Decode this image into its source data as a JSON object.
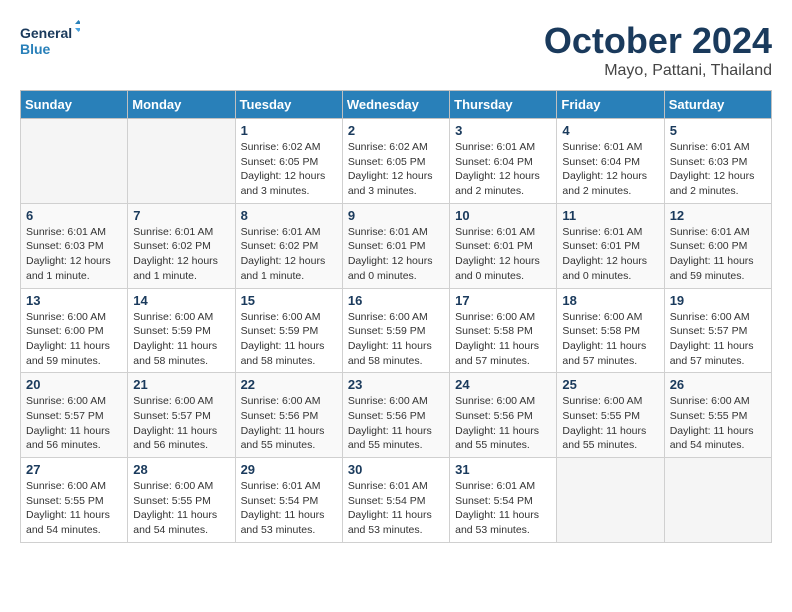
{
  "logo": {
    "general": "General",
    "blue": "Blue"
  },
  "header": {
    "month": "October 2024",
    "location": "Mayo, Pattani, Thailand"
  },
  "weekdays": [
    "Sunday",
    "Monday",
    "Tuesday",
    "Wednesday",
    "Thursday",
    "Friday",
    "Saturday"
  ],
  "weeks": [
    [
      {
        "day": "",
        "info": ""
      },
      {
        "day": "",
        "info": ""
      },
      {
        "day": "1",
        "info": "Sunrise: 6:02 AM\nSunset: 6:05 PM\nDaylight: 12 hours and 3 minutes."
      },
      {
        "day": "2",
        "info": "Sunrise: 6:02 AM\nSunset: 6:05 PM\nDaylight: 12 hours and 3 minutes."
      },
      {
        "day": "3",
        "info": "Sunrise: 6:01 AM\nSunset: 6:04 PM\nDaylight: 12 hours and 2 minutes."
      },
      {
        "day": "4",
        "info": "Sunrise: 6:01 AM\nSunset: 6:04 PM\nDaylight: 12 hours and 2 minutes."
      },
      {
        "day": "5",
        "info": "Sunrise: 6:01 AM\nSunset: 6:03 PM\nDaylight: 12 hours and 2 minutes."
      }
    ],
    [
      {
        "day": "6",
        "info": "Sunrise: 6:01 AM\nSunset: 6:03 PM\nDaylight: 12 hours and 1 minute."
      },
      {
        "day": "7",
        "info": "Sunrise: 6:01 AM\nSunset: 6:02 PM\nDaylight: 12 hours and 1 minute."
      },
      {
        "day": "8",
        "info": "Sunrise: 6:01 AM\nSunset: 6:02 PM\nDaylight: 12 hours and 1 minute."
      },
      {
        "day": "9",
        "info": "Sunrise: 6:01 AM\nSunset: 6:01 PM\nDaylight: 12 hours and 0 minutes."
      },
      {
        "day": "10",
        "info": "Sunrise: 6:01 AM\nSunset: 6:01 PM\nDaylight: 12 hours and 0 minutes."
      },
      {
        "day": "11",
        "info": "Sunrise: 6:01 AM\nSunset: 6:01 PM\nDaylight: 12 hours and 0 minutes."
      },
      {
        "day": "12",
        "info": "Sunrise: 6:01 AM\nSunset: 6:00 PM\nDaylight: 11 hours and 59 minutes."
      }
    ],
    [
      {
        "day": "13",
        "info": "Sunrise: 6:00 AM\nSunset: 6:00 PM\nDaylight: 11 hours and 59 minutes."
      },
      {
        "day": "14",
        "info": "Sunrise: 6:00 AM\nSunset: 5:59 PM\nDaylight: 11 hours and 58 minutes."
      },
      {
        "day": "15",
        "info": "Sunrise: 6:00 AM\nSunset: 5:59 PM\nDaylight: 11 hours and 58 minutes."
      },
      {
        "day": "16",
        "info": "Sunrise: 6:00 AM\nSunset: 5:59 PM\nDaylight: 11 hours and 58 minutes."
      },
      {
        "day": "17",
        "info": "Sunrise: 6:00 AM\nSunset: 5:58 PM\nDaylight: 11 hours and 57 minutes."
      },
      {
        "day": "18",
        "info": "Sunrise: 6:00 AM\nSunset: 5:58 PM\nDaylight: 11 hours and 57 minutes."
      },
      {
        "day": "19",
        "info": "Sunrise: 6:00 AM\nSunset: 5:57 PM\nDaylight: 11 hours and 57 minutes."
      }
    ],
    [
      {
        "day": "20",
        "info": "Sunrise: 6:00 AM\nSunset: 5:57 PM\nDaylight: 11 hours and 56 minutes."
      },
      {
        "day": "21",
        "info": "Sunrise: 6:00 AM\nSunset: 5:57 PM\nDaylight: 11 hours and 56 minutes."
      },
      {
        "day": "22",
        "info": "Sunrise: 6:00 AM\nSunset: 5:56 PM\nDaylight: 11 hours and 55 minutes."
      },
      {
        "day": "23",
        "info": "Sunrise: 6:00 AM\nSunset: 5:56 PM\nDaylight: 11 hours and 55 minutes."
      },
      {
        "day": "24",
        "info": "Sunrise: 6:00 AM\nSunset: 5:56 PM\nDaylight: 11 hours and 55 minutes."
      },
      {
        "day": "25",
        "info": "Sunrise: 6:00 AM\nSunset: 5:55 PM\nDaylight: 11 hours and 55 minutes."
      },
      {
        "day": "26",
        "info": "Sunrise: 6:00 AM\nSunset: 5:55 PM\nDaylight: 11 hours and 54 minutes."
      }
    ],
    [
      {
        "day": "27",
        "info": "Sunrise: 6:00 AM\nSunset: 5:55 PM\nDaylight: 11 hours and 54 minutes."
      },
      {
        "day": "28",
        "info": "Sunrise: 6:00 AM\nSunset: 5:55 PM\nDaylight: 11 hours and 54 minutes."
      },
      {
        "day": "29",
        "info": "Sunrise: 6:01 AM\nSunset: 5:54 PM\nDaylight: 11 hours and 53 minutes."
      },
      {
        "day": "30",
        "info": "Sunrise: 6:01 AM\nSunset: 5:54 PM\nDaylight: 11 hours and 53 minutes."
      },
      {
        "day": "31",
        "info": "Sunrise: 6:01 AM\nSunset: 5:54 PM\nDaylight: 11 hours and 53 minutes."
      },
      {
        "day": "",
        "info": ""
      },
      {
        "day": "",
        "info": ""
      }
    ]
  ]
}
